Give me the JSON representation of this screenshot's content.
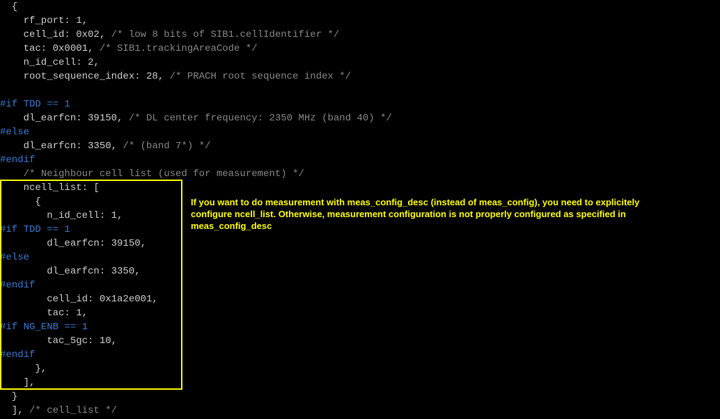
{
  "code": {
    "l0": "  {",
    "l1": "    rf_port: 1,",
    "l2": "    cell_id: 0x02, ",
    "l2c": "/* low 8 bits of SIB1.cellIdentifier */",
    "l3": "    tac: 0x0001, ",
    "l3c": "/* SIB1.trackingAreaCode */",
    "l4": "    n_id_cell: 2,",
    "l5": "    root_sequence_index: 28, ",
    "l5c": "/* PRACH root sequence index */",
    "l6": "",
    "l7": "#if TDD == 1",
    "l8": "    dl_earfcn: 39150, ",
    "l8c": "/* DL center frequency: 2350 MHz (band 40) */",
    "l9": "#else",
    "l10": "    dl_earfcn: 3350, ",
    "l10c": "/* (band 7*) */",
    "l11": "#endif",
    "l12": "    ",
    "l12c": "/* Neighbour cell list (used for measurement) */",
    "l13": "    ncell_list: [",
    "l14": "      {",
    "l15": "        n_id_cell: 1,",
    "l16": "#if TDD == 1",
    "l17": "        dl_earfcn: 39150,",
    "l18": "#else",
    "l19": "        dl_earfcn: 3350,",
    "l20": "#endif",
    "l21": "        cell_id: 0x1a2e001,",
    "l22": "        tac: 1,",
    "l23": "#if NG_ENB == 1",
    "l24": "        tac_5gc: 10,",
    "l25": "#endif",
    "l26": "      },",
    "l27": "    ],",
    "l28": "  }",
    "l29": "  ], ",
    "l29c": "/* cell_list */"
  },
  "callout_text": "If you want to do measurement with meas_config_desc (instead of meas_config), you need to explicitely configure ncell_list. Otherwise, measurement configuration is not properly configured as specified in meas_config_desc"
}
